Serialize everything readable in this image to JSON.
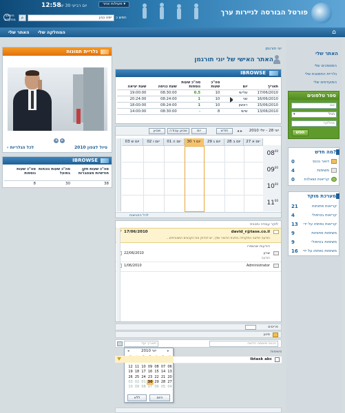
{
  "header": {
    "portal_title": "פורטל הבורסה לניירות ערך",
    "clock_time": "12:58",
    "clock_date": "יום רביעי  30  יוני",
    "other_actions": "פעולות אחר",
    "search_label": "חפש כ",
    "search_value": "יפה כהן",
    "advanced_search": "חיפוש מתקדם"
  },
  "nav": {
    "my_department": "המחלקה שלי",
    "my_site": "האתר שלי"
  },
  "sidebar": {
    "title": "האתר שלי",
    "links": [
      "המסמכים שלי",
      "גלריית התמונות שלי",
      "המועדפים שלי"
    ]
  },
  "phonebook": {
    "title": "ספר טלפונים",
    "field1_placeholder": "שם",
    "select_value": "הכל",
    "field3_placeholder": "מחלקה",
    "search_button": "חפש"
  },
  "whats_new": {
    "title": "מה חדש?",
    "items": [
      {
        "label": "דואר נכנס",
        "count": "0"
      },
      {
        "label": "משימות",
        "count": "4"
      },
      {
        "label": "קריאות ושאלות",
        "count": "0"
      }
    ]
  },
  "helpdesk": {
    "title": "מערכת מוקד",
    "items": [
      {
        "label": "קריאות פתוחות",
        "count": "21"
      },
      {
        "label": "קריאות בטיפולי",
        "count": "4"
      },
      {
        "label": "קריאות נפתחו על ידי",
        "count": "13"
      },
      {
        "label": "משימות פתוחות",
        "count": "9"
      },
      {
        "label": "משימות בטיפולי",
        "count": "9"
      },
      {
        "label": "משימות נפתחו על ידי",
        "count": "16"
      }
    ]
  },
  "personal": {
    "breadcrumb": "יוני תורגמן",
    "title": "האתר האישי של יוני תורגמן"
  },
  "ibrowse_main": {
    "title": "IBROWSE",
    "columns": [
      "תאריך",
      "יום",
      "סה\"כ שעות",
      "סה\"כ שעות נוספות",
      "שעת כניסה",
      "שעת יציאה"
    ],
    "rows": [
      [
        "17/06/2010",
        "שלישי",
        "10",
        "0.5",
        "08:30:00",
        "19:00:00"
      ],
      [
        "16/06/2010",
        "שני",
        "10",
        "1",
        "08:24:00",
        "20:24:00"
      ],
      [
        "15/06/2010",
        "ראשון",
        "10",
        "1",
        "08:24:00",
        "18:00:00"
      ],
      [
        "13/06/2010",
        "שישי",
        "8",
        "-",
        "08:30:00",
        "14:00:00"
      ]
    ]
  },
  "calendar_toolbar": {
    "date_range": "יוני 28 - יולי 2010",
    "buttons": [
      "חודש",
      "שבוע עבודה",
      "שבוע",
      "יום"
    ]
  },
  "week": {
    "days": [
      "27 יום א",
      "28 יום ב",
      "29 יום ג",
      "30 יום ד",
      "01 יום ה",
      "02 יום ו",
      "03 יום ש"
    ],
    "hours": [
      "08",
      "09",
      "10",
      "11"
    ],
    "superscript": "00",
    "footer": "לכל הפגישות"
  },
  "messages": {
    "header": "לוקר עבודה ותכנית",
    "item1_from": "david_r@tase.co.il",
    "item1_date": "17/06/2010",
    "item1_text": "הודעה חדשה התקבלה בתיבת הדואר שלך, יש לבדוק את הקבצים המצורפים...",
    "group2": "הודעות שנשמרו",
    "item2_from": "שרון",
    "item2_date": "22/06/2010",
    "item2_sub": "הודעה",
    "item3_from": "Administrator",
    "item3_date": "1/06/2010"
  },
  "tasks": {
    "footer_label": "פריטים",
    "search_placeholder": "הכנס משימה חדשה",
    "date_placeholder": "תאריך יעד",
    "status_label": "סינון",
    "list_title": "משימות",
    "task_name": "ibtask abc",
    "due": "מועד יעד"
  },
  "mini_calendar": {
    "month_label": "יוני 2010",
    "weekdays": [
      "א",
      "ב",
      "ג",
      "ד",
      "ה",
      "ו",
      "ש"
    ],
    "weeks": [
      [
        "30",
        "31",
        "01",
        "02",
        "03",
        "04",
        "05"
      ],
      [
        "06",
        "07",
        "08",
        "09",
        "10",
        "11",
        "12"
      ],
      [
        "13",
        "14",
        "15",
        "16",
        "17",
        "18",
        "19"
      ],
      [
        "20",
        "21",
        "22",
        "23",
        "24",
        "25",
        "26"
      ],
      [
        "27",
        "28",
        "29",
        "30",
        "01",
        "02",
        "03"
      ],
      [
        "04",
        "05",
        "06",
        "07",
        "08",
        "09",
        "10"
      ]
    ],
    "today_button": "היום",
    "none_button": "ללא"
  },
  "gallery": {
    "title": "גלריית תמונות",
    "caption": "טיול לצפון 2010",
    "link": "לכל הגלריות"
  },
  "ibrowse_small": {
    "title": "IBROWSE",
    "columns": [
      "סה\"כ שעות תקן חודשיות מצטברות",
      "סה\"כ שעות נוכחות בפועל",
      "סה\"כ שעות נוספות"
    ],
    "values": [
      "38",
      "30",
      "8"
    ]
  },
  "colors": {
    "brand_blue": "#1f5f95",
    "accent_orange": "#e2700a",
    "accent_green": "#4f8a20",
    "link_blue": "#1d5c9a",
    "highlight_day": "#f7c36a"
  }
}
